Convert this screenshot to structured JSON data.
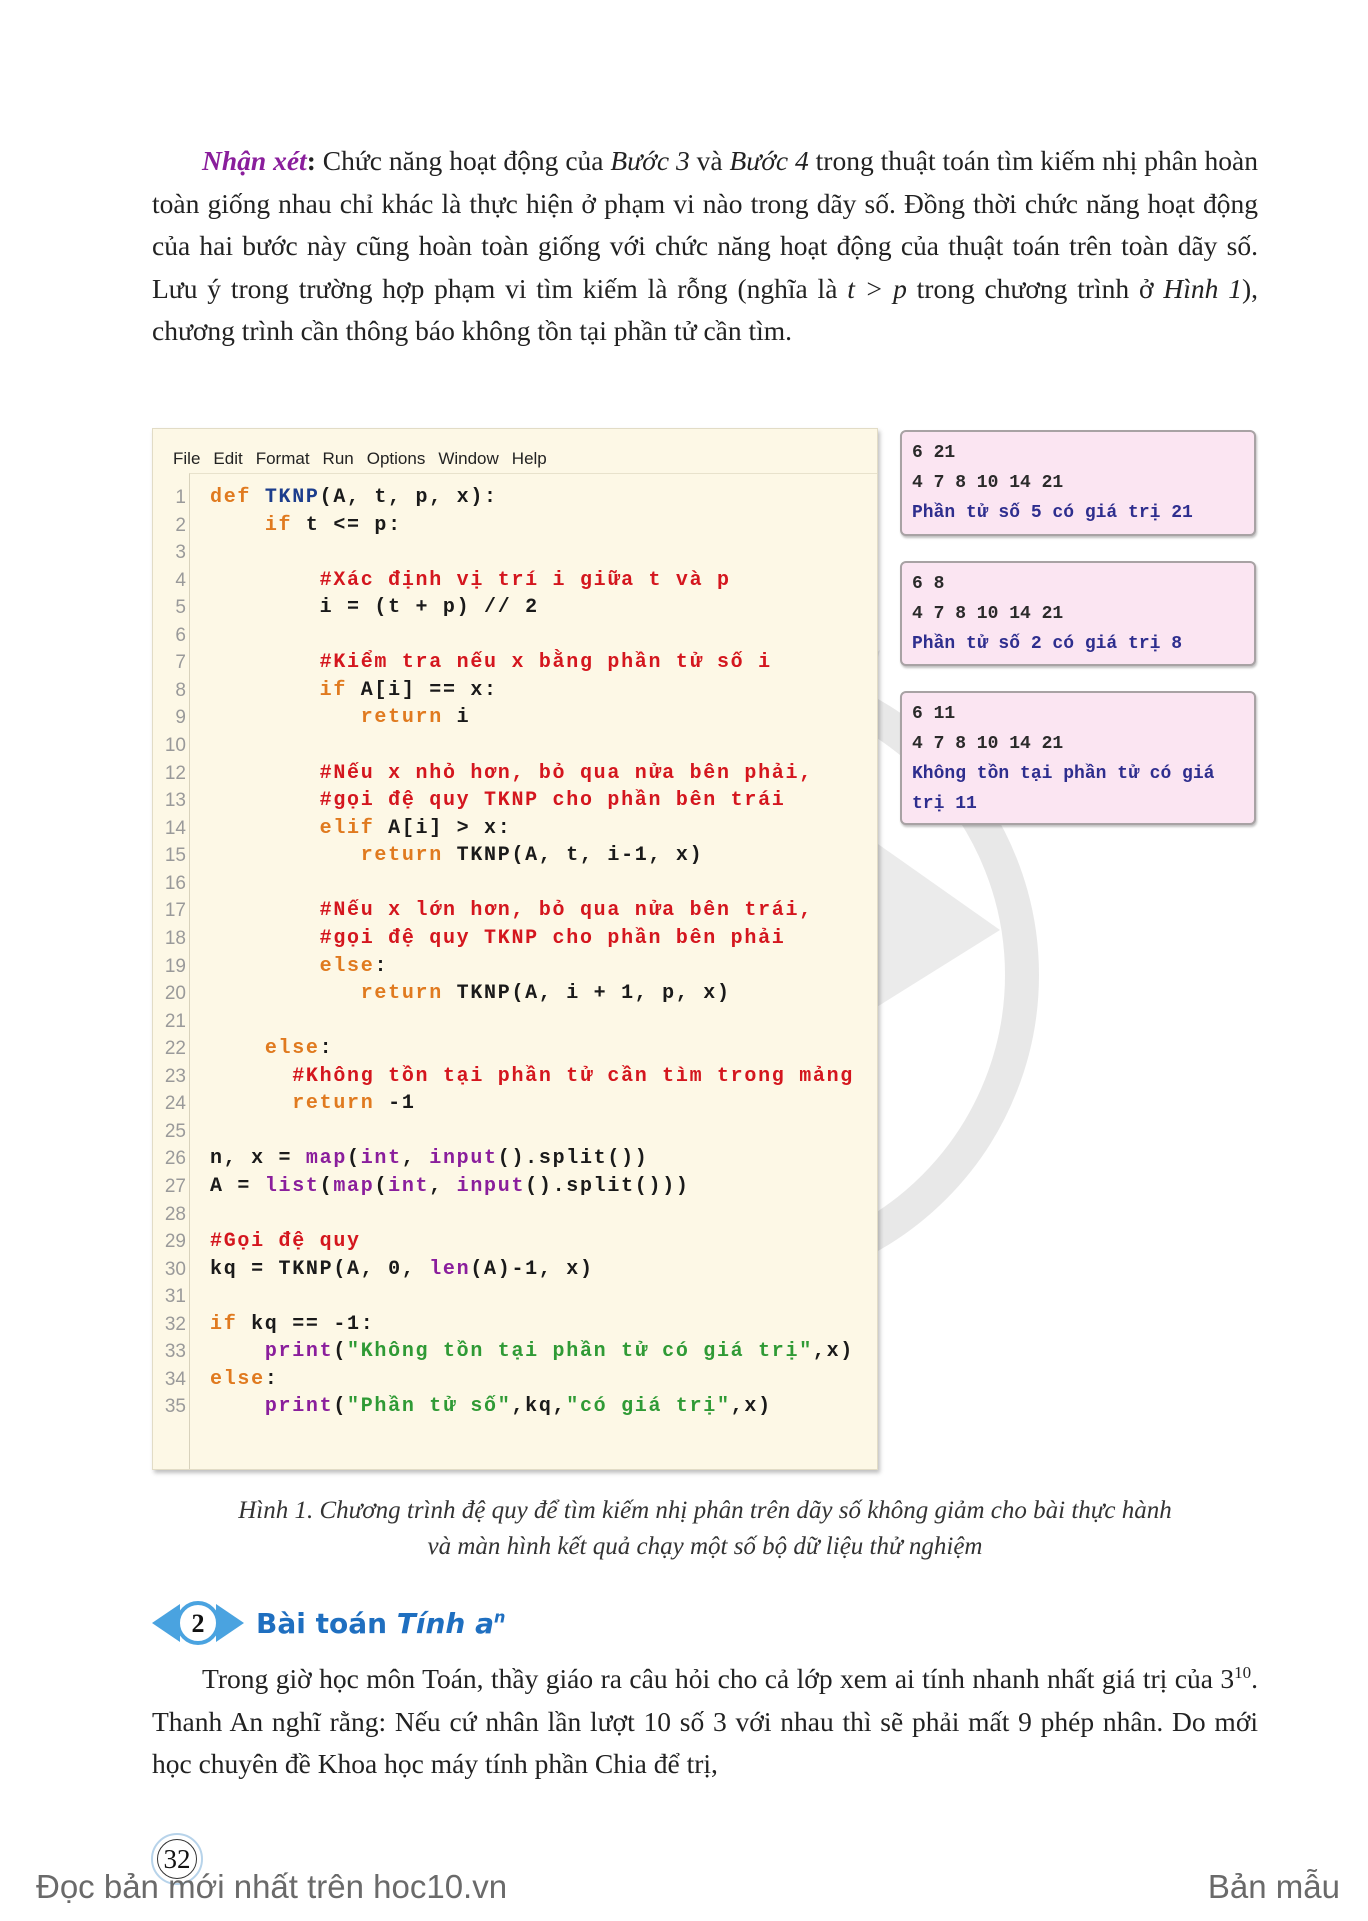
{
  "paragraph1": [
    [
      "bi",
      "Nhận xét"
    ],
    [
      "b",
      ": "
    ],
    [
      "",
      "Chức năng hoạt động của "
    ],
    [
      "i",
      "Bước 3"
    ],
    [
      "",
      " và "
    ],
    [
      "i",
      "Bước 4"
    ],
    [
      "",
      " trong thuật toán tìm kiếm nhị phân hoàn toàn giống nhau chỉ khác là thực hiện ở phạm vi nào trong dãy số. Đồng thời chức năng hoạt động của hai bước này cũng hoàn toàn giống với chức năng hoạt động của thuật toán trên toàn dãy số. Lưu ý trong trường hợp phạm vi tìm kiếm là rỗng (nghĩa là "
    ],
    [
      "i",
      "t > p"
    ],
    [
      "",
      " trong chương trình ở "
    ],
    [
      "i",
      "Hình 1"
    ],
    [
      "",
      "), chương trình cần thông báo không tồn tại phần tử cần tìm."
    ]
  ],
  "editor": {
    "menu": [
      "File",
      "Edit",
      "Format",
      "Run",
      "Options",
      "Window",
      "Help"
    ],
    "lines": [
      {
        "n": "1",
        "tokens": [
          [
            "kw",
            "def"
          ],
          [
            "tx",
            " "
          ],
          [
            "fn",
            "TKNP"
          ],
          [
            "tx",
            "(A, t, p, x):"
          ]
        ]
      },
      {
        "n": "2",
        "tokens": [
          [
            "tx",
            "    "
          ],
          [
            "kw",
            "if"
          ],
          [
            "tx",
            " t <= p:"
          ]
        ]
      },
      {
        "n": "3",
        "tokens": []
      },
      {
        "n": "4",
        "tokens": [
          [
            "tx",
            "        "
          ],
          [
            "cm",
            "#Xác định vị trí i giữa t và p"
          ]
        ]
      },
      {
        "n": "5",
        "tokens": [
          [
            "tx",
            "        i = (t + p) // 2"
          ]
        ]
      },
      {
        "n": "6",
        "tokens": []
      },
      {
        "n": "7",
        "tokens": [
          [
            "tx",
            "        "
          ],
          [
            "cm",
            "#Kiểm tra nếu x bằng phần tử số i"
          ]
        ]
      },
      {
        "n": "8",
        "tokens": [
          [
            "tx",
            "        "
          ],
          [
            "kw",
            "if"
          ],
          [
            "tx",
            " A[i] == x:"
          ]
        ]
      },
      {
        "n": "9",
        "tokens": [
          [
            "tx",
            "           "
          ],
          [
            "kw",
            "return"
          ],
          [
            "tx",
            " i"
          ]
        ]
      },
      {
        "n": "10",
        "tokens": []
      },
      {
        "n": "12",
        "tokens": [
          [
            "tx",
            "        "
          ],
          [
            "cm",
            "#Nếu x nhỏ hơn, bỏ qua nửa bên phải,"
          ]
        ]
      },
      {
        "n": "13",
        "tokens": [
          [
            "tx",
            "        "
          ],
          [
            "cm",
            "#gọi đệ quy TKNP cho phần bên trái"
          ]
        ]
      },
      {
        "n": "14",
        "tokens": [
          [
            "tx",
            "        "
          ],
          [
            "kw",
            "elif"
          ],
          [
            "tx",
            " A[i] > x:"
          ]
        ]
      },
      {
        "n": "15",
        "tokens": [
          [
            "tx",
            "           "
          ],
          [
            "kw",
            "return"
          ],
          [
            "tx",
            " TKNP(A, t, i-1, x)"
          ]
        ]
      },
      {
        "n": "16",
        "tokens": []
      },
      {
        "n": "17",
        "tokens": [
          [
            "tx",
            "        "
          ],
          [
            "cm",
            "#Nếu x lớn hơn, bỏ qua nửa bên trái,"
          ]
        ]
      },
      {
        "n": "18",
        "tokens": [
          [
            "tx",
            "        "
          ],
          [
            "cm",
            "#gọi đệ quy TKNP cho phần bên phải"
          ]
        ]
      },
      {
        "n": "19",
        "tokens": [
          [
            "tx",
            "        "
          ],
          [
            "kw",
            "else"
          ],
          [
            "tx",
            ":"
          ]
        ]
      },
      {
        "n": "20",
        "tokens": [
          [
            "tx",
            "           "
          ],
          [
            "kw",
            "return"
          ],
          [
            "tx",
            " TKNP(A, i + 1, p, x)"
          ]
        ]
      },
      {
        "n": "21",
        "tokens": []
      },
      {
        "n": "22",
        "tokens": [
          [
            "tx",
            "    "
          ],
          [
            "kw",
            "else"
          ],
          [
            "tx",
            ":"
          ]
        ]
      },
      {
        "n": "23",
        "tokens": [
          [
            "tx",
            "      "
          ],
          [
            "cm",
            "#Không tồn tại phần tử cần tìm trong mảng"
          ]
        ]
      },
      {
        "n": "24",
        "tokens": [
          [
            "tx",
            "      "
          ],
          [
            "kw",
            "return"
          ],
          [
            "tx",
            " -1"
          ]
        ]
      },
      {
        "n": "25",
        "tokens": []
      },
      {
        "n": "26",
        "tokens": [
          [
            "tx",
            "n, x = "
          ],
          [
            "bi",
            "map"
          ],
          [
            "tx",
            "("
          ],
          [
            "bi",
            "int"
          ],
          [
            "tx",
            ", "
          ],
          [
            "bi",
            "input"
          ],
          [
            "tx",
            "().split())"
          ]
        ]
      },
      {
        "n": "27",
        "tokens": [
          [
            "tx",
            "A = "
          ],
          [
            "bi",
            "list"
          ],
          [
            "tx",
            "("
          ],
          [
            "bi",
            "map"
          ],
          [
            "tx",
            "("
          ],
          [
            "bi",
            "int"
          ],
          [
            "tx",
            ", "
          ],
          [
            "bi",
            "input"
          ],
          [
            "tx",
            "().split()))"
          ]
        ]
      },
      {
        "n": "28",
        "tokens": []
      },
      {
        "n": "29",
        "tokens": [
          [
            "cm",
            "#Gọi đệ quy"
          ]
        ]
      },
      {
        "n": "30",
        "tokens": [
          [
            "tx",
            "kq = TKNP(A, 0, "
          ],
          [
            "bi",
            "len"
          ],
          [
            "tx",
            "(A)-1, x)"
          ]
        ]
      },
      {
        "n": "31",
        "tokens": []
      },
      {
        "n": "32",
        "tokens": [
          [
            "kw",
            "if"
          ],
          [
            "tx",
            " kq == -1:"
          ]
        ]
      },
      {
        "n": "33",
        "tokens": [
          [
            "tx",
            "    "
          ],
          [
            "bi",
            "print"
          ],
          [
            "tx",
            "("
          ],
          [
            "st",
            "\"Không tồn tại phần tử có giá trị\""
          ],
          [
            "tx",
            ",x)"
          ]
        ]
      },
      {
        "n": "34",
        "tokens": [
          [
            "kw",
            "else"
          ],
          [
            "tx",
            ":"
          ]
        ]
      },
      {
        "n": "35",
        "tokens": [
          [
            "tx",
            "    "
          ],
          [
            "bi",
            "print"
          ],
          [
            "tx",
            "("
          ],
          [
            "st",
            "\"Phần tử số\""
          ],
          [
            "tx",
            ",kq,"
          ],
          [
            "st",
            "\"có giá trị\""
          ],
          [
            "tx",
            ",x)"
          ]
        ]
      }
    ]
  },
  "outputs": [
    {
      "input1": "6 21",
      "input2": "4 7 8 10 14 21",
      "result": "Phần tử số 5 có giá trị 21"
    },
    {
      "input1": "6 8",
      "input2": "4 7 8 10 14 21",
      "result": "Phần tử số 2 có giá trị 8"
    },
    {
      "input1": "6 11",
      "input2": "4 7 8 10 14 21",
      "result": "Không tồn tại phần tử có giá trị 11"
    }
  ],
  "caption": {
    "line1": "Hình 1. Chương trình đệ quy để tìm kiếm nhị phân trên dãy số không giảm cho bài thực hành",
    "line2": "và màn hình kết quả chạy một số bộ dữ liệu thử nghiệm"
  },
  "section": {
    "number": "2",
    "title": "Bài toán ",
    "title_italic": "Tính a",
    "superscript": "n"
  },
  "paragraph2": [
    [
      "",
      "Trong giờ học môn Toán, thầy giáo ra câu hỏi cho cả lớp xem ai tính nhanh nhất giá trị của 3"
    ],
    [
      "sup",
      "10"
    ],
    [
      "",
      ". Thanh An nghĩ rằng: Nếu cứ nhân lần lượt 10 số 3 với nhau thì sẽ phải mất 9 phép nhân. Do mới học chuyên đề Khoa học máy tính phần Chia để trị,"
    ]
  ],
  "page_number": "32",
  "footer": {
    "left": "Đọc bản mới nhất trên hoc10.vn",
    "right": "Bản mẫu"
  },
  "colors": {
    "keyword": "#e07a1f",
    "function": "#1c3d8c",
    "builtin": "#8a1e9c",
    "comment": "#d4161e",
    "string": "#2f9a35",
    "heading": "#1f6fc0",
    "output_bg": "#fbe5f2",
    "editor_bg": "#fdf8e6"
  }
}
